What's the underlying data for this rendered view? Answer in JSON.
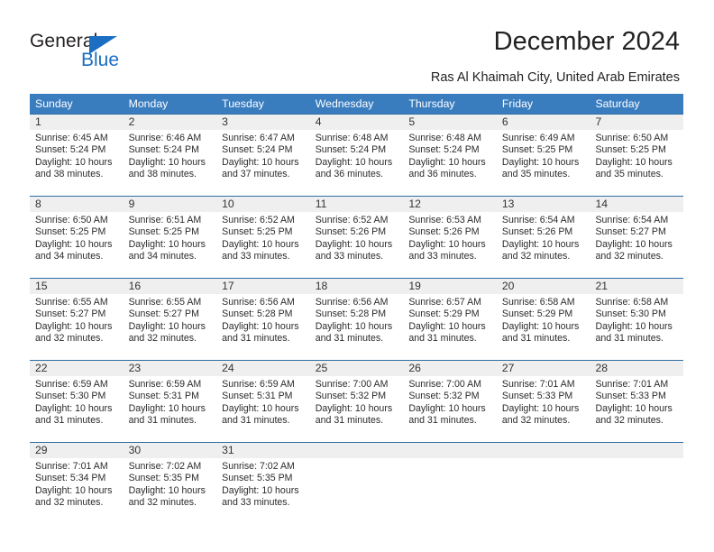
{
  "brand": {
    "name_part1": "General",
    "name_part2": "Blue",
    "triangle_color": "#1b6ec2"
  },
  "header": {
    "title": "December 2024",
    "subtitle": "Ras Al Khaimah City, United Arab Emirates"
  },
  "theme": {
    "header_bg": "#3a7dbf",
    "row_divider": "#2e6da4",
    "daynum_band": "#efefef",
    "text": "#2b2b2b"
  },
  "weekdays": [
    "Sunday",
    "Monday",
    "Tuesday",
    "Wednesday",
    "Thursday",
    "Friday",
    "Saturday"
  ],
  "weeks": [
    {
      "days": [
        {
          "number": "1",
          "sunrise": "Sunrise: 6:45 AM",
          "sunset": "Sunset: 5:24 PM",
          "daylight_line1": "Daylight: 10 hours",
          "daylight_line2": "and 38 minutes."
        },
        {
          "number": "2",
          "sunrise": "Sunrise: 6:46 AM",
          "sunset": "Sunset: 5:24 PM",
          "daylight_line1": "Daylight: 10 hours",
          "daylight_line2": "and 38 minutes."
        },
        {
          "number": "3",
          "sunrise": "Sunrise: 6:47 AM",
          "sunset": "Sunset: 5:24 PM",
          "daylight_line1": "Daylight: 10 hours",
          "daylight_line2": "and 37 minutes."
        },
        {
          "number": "4",
          "sunrise": "Sunrise: 6:48 AM",
          "sunset": "Sunset: 5:24 PM",
          "daylight_line1": "Daylight: 10 hours",
          "daylight_line2": "and 36 minutes."
        },
        {
          "number": "5",
          "sunrise": "Sunrise: 6:48 AM",
          "sunset": "Sunset: 5:24 PM",
          "daylight_line1": "Daylight: 10 hours",
          "daylight_line2": "and 36 minutes."
        },
        {
          "number": "6",
          "sunrise": "Sunrise: 6:49 AM",
          "sunset": "Sunset: 5:25 PM",
          "daylight_line1": "Daylight: 10 hours",
          "daylight_line2": "and 35 minutes."
        },
        {
          "number": "7",
          "sunrise": "Sunrise: 6:50 AM",
          "sunset": "Sunset: 5:25 PM",
          "daylight_line1": "Daylight: 10 hours",
          "daylight_line2": "and 35 minutes."
        }
      ]
    },
    {
      "days": [
        {
          "number": "8",
          "sunrise": "Sunrise: 6:50 AM",
          "sunset": "Sunset: 5:25 PM",
          "daylight_line1": "Daylight: 10 hours",
          "daylight_line2": "and 34 minutes."
        },
        {
          "number": "9",
          "sunrise": "Sunrise: 6:51 AM",
          "sunset": "Sunset: 5:25 PM",
          "daylight_line1": "Daylight: 10 hours",
          "daylight_line2": "and 34 minutes."
        },
        {
          "number": "10",
          "sunrise": "Sunrise: 6:52 AM",
          "sunset": "Sunset: 5:25 PM",
          "daylight_line1": "Daylight: 10 hours",
          "daylight_line2": "and 33 minutes."
        },
        {
          "number": "11",
          "sunrise": "Sunrise: 6:52 AM",
          "sunset": "Sunset: 5:26 PM",
          "daylight_line1": "Daylight: 10 hours",
          "daylight_line2": "and 33 minutes."
        },
        {
          "number": "12",
          "sunrise": "Sunrise: 6:53 AM",
          "sunset": "Sunset: 5:26 PM",
          "daylight_line1": "Daylight: 10 hours",
          "daylight_line2": "and 33 minutes."
        },
        {
          "number": "13",
          "sunrise": "Sunrise: 6:54 AM",
          "sunset": "Sunset: 5:26 PM",
          "daylight_line1": "Daylight: 10 hours",
          "daylight_line2": "and 32 minutes."
        },
        {
          "number": "14",
          "sunrise": "Sunrise: 6:54 AM",
          "sunset": "Sunset: 5:27 PM",
          "daylight_line1": "Daylight: 10 hours",
          "daylight_line2": "and 32 minutes."
        }
      ]
    },
    {
      "days": [
        {
          "number": "15",
          "sunrise": "Sunrise: 6:55 AM",
          "sunset": "Sunset: 5:27 PM",
          "daylight_line1": "Daylight: 10 hours",
          "daylight_line2": "and 32 minutes."
        },
        {
          "number": "16",
          "sunrise": "Sunrise: 6:55 AM",
          "sunset": "Sunset: 5:27 PM",
          "daylight_line1": "Daylight: 10 hours",
          "daylight_line2": "and 32 minutes."
        },
        {
          "number": "17",
          "sunrise": "Sunrise: 6:56 AM",
          "sunset": "Sunset: 5:28 PM",
          "daylight_line1": "Daylight: 10 hours",
          "daylight_line2": "and 31 minutes."
        },
        {
          "number": "18",
          "sunrise": "Sunrise: 6:56 AM",
          "sunset": "Sunset: 5:28 PM",
          "daylight_line1": "Daylight: 10 hours",
          "daylight_line2": "and 31 minutes."
        },
        {
          "number": "19",
          "sunrise": "Sunrise: 6:57 AM",
          "sunset": "Sunset: 5:29 PM",
          "daylight_line1": "Daylight: 10 hours",
          "daylight_line2": "and 31 minutes."
        },
        {
          "number": "20",
          "sunrise": "Sunrise: 6:58 AM",
          "sunset": "Sunset: 5:29 PM",
          "daylight_line1": "Daylight: 10 hours",
          "daylight_line2": "and 31 minutes."
        },
        {
          "number": "21",
          "sunrise": "Sunrise: 6:58 AM",
          "sunset": "Sunset: 5:30 PM",
          "daylight_line1": "Daylight: 10 hours",
          "daylight_line2": "and 31 minutes."
        }
      ]
    },
    {
      "days": [
        {
          "number": "22",
          "sunrise": "Sunrise: 6:59 AM",
          "sunset": "Sunset: 5:30 PM",
          "daylight_line1": "Daylight: 10 hours",
          "daylight_line2": "and 31 minutes."
        },
        {
          "number": "23",
          "sunrise": "Sunrise: 6:59 AM",
          "sunset": "Sunset: 5:31 PM",
          "daylight_line1": "Daylight: 10 hours",
          "daylight_line2": "and 31 minutes."
        },
        {
          "number": "24",
          "sunrise": "Sunrise: 6:59 AM",
          "sunset": "Sunset: 5:31 PM",
          "daylight_line1": "Daylight: 10 hours",
          "daylight_line2": "and 31 minutes."
        },
        {
          "number": "25",
          "sunrise": "Sunrise: 7:00 AM",
          "sunset": "Sunset: 5:32 PM",
          "daylight_line1": "Daylight: 10 hours",
          "daylight_line2": "and 31 minutes."
        },
        {
          "number": "26",
          "sunrise": "Sunrise: 7:00 AM",
          "sunset": "Sunset: 5:32 PM",
          "daylight_line1": "Daylight: 10 hours",
          "daylight_line2": "and 31 minutes."
        },
        {
          "number": "27",
          "sunrise": "Sunrise: 7:01 AM",
          "sunset": "Sunset: 5:33 PM",
          "daylight_line1": "Daylight: 10 hours",
          "daylight_line2": "and 32 minutes."
        },
        {
          "number": "28",
          "sunrise": "Sunrise: 7:01 AM",
          "sunset": "Sunset: 5:33 PM",
          "daylight_line1": "Daylight: 10 hours",
          "daylight_line2": "and 32 minutes."
        }
      ]
    },
    {
      "days": [
        {
          "number": "29",
          "sunrise": "Sunrise: 7:01 AM",
          "sunset": "Sunset: 5:34 PM",
          "daylight_line1": "Daylight: 10 hours",
          "daylight_line2": "and 32 minutes."
        },
        {
          "number": "30",
          "sunrise": "Sunrise: 7:02 AM",
          "sunset": "Sunset: 5:35 PM",
          "daylight_line1": "Daylight: 10 hours",
          "daylight_line2": "and 32 minutes."
        },
        {
          "number": "31",
          "sunrise": "Sunrise: 7:02 AM",
          "sunset": "Sunset: 5:35 PM",
          "daylight_line1": "Daylight: 10 hours",
          "daylight_line2": "and 33 minutes."
        },
        {
          "number": "",
          "sunrise": "",
          "sunset": "",
          "daylight_line1": "",
          "daylight_line2": ""
        },
        {
          "number": "",
          "sunrise": "",
          "sunset": "",
          "daylight_line1": "",
          "daylight_line2": ""
        },
        {
          "number": "",
          "sunrise": "",
          "sunset": "",
          "daylight_line1": "",
          "daylight_line2": ""
        },
        {
          "number": "",
          "sunrise": "",
          "sunset": "",
          "daylight_line1": "",
          "daylight_line2": ""
        }
      ]
    }
  ]
}
